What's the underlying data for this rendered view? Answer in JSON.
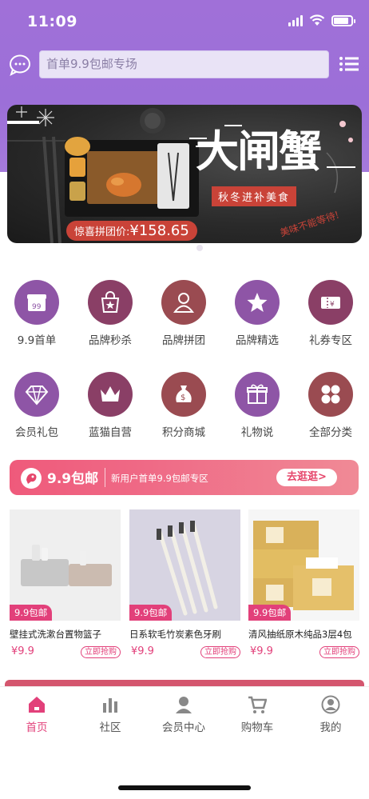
{
  "status_bar": {
    "time": "11:09"
  },
  "search": {
    "placeholder": "首单9.9包邮专场"
  },
  "banner": {
    "title": "大闸蟹",
    "subtitle": "秋冬进补美食",
    "price_label": "惊喜拼团价:",
    "price": "¥158.65",
    "signature": "美味不能等待!"
  },
  "grid": [
    {
      "label": "9.9首单",
      "icon": "gift-box-99-icon",
      "color": "#8e55a6"
    },
    {
      "label": "品牌秒杀",
      "icon": "shopping-bag-star-icon",
      "color": "#8a3f66"
    },
    {
      "label": "品牌拼团",
      "icon": "group-people-icon",
      "color": "#9a4b51"
    },
    {
      "label": "品牌精选",
      "icon": "star-icon",
      "color": "#8e55a6"
    },
    {
      "label": "礼券专区",
      "icon": "coupon-icon",
      "color": "#8a3f66"
    },
    {
      "label": "会员礼包",
      "icon": "diamond-icon",
      "color": "#8e55a6"
    },
    {
      "label": "蓝猫自营",
      "icon": "crown-icon",
      "color": "#8a3f66"
    },
    {
      "label": "积分商城",
      "icon": "money-bag-icon",
      "color": "#9a4b51"
    },
    {
      "label": "礼物说",
      "icon": "gift-icon",
      "color": "#8e55a6"
    },
    {
      "label": "全部分类",
      "icon": "category-grid-icon",
      "color": "#9a4b51"
    }
  ],
  "promo": {
    "title": "9.9包邮",
    "subtitle": "新用户首单9.9包邮专区",
    "button": "去逛逛>"
  },
  "products": [
    {
      "badge": "9.9包邮",
      "title": "壁挂式洗漱台置物篮子",
      "price": "¥9.9",
      "buy": "立即抢购"
    },
    {
      "badge": "9.9包邮",
      "title": "日系软毛竹炭素色牙刷",
      "price": "¥9.9",
      "buy": "立即抢购"
    },
    {
      "badge": "9.9包邮",
      "title": "清风抽纸原木纯品3层4包",
      "price": "¥9.9",
      "buy": "立即抢购"
    }
  ],
  "tabs": [
    {
      "label": "首页",
      "icon": "home-icon",
      "active": true
    },
    {
      "label": "社区",
      "icon": "bar-chart-icon",
      "active": false
    },
    {
      "label": "会员中心",
      "icon": "user-icon",
      "active": false
    },
    {
      "label": "购物车",
      "icon": "cart-icon",
      "active": false
    },
    {
      "label": "我的",
      "icon": "profile-circle-icon",
      "active": false
    }
  ],
  "colors": {
    "brand": "#e2407a",
    "header": "#a070d8"
  }
}
